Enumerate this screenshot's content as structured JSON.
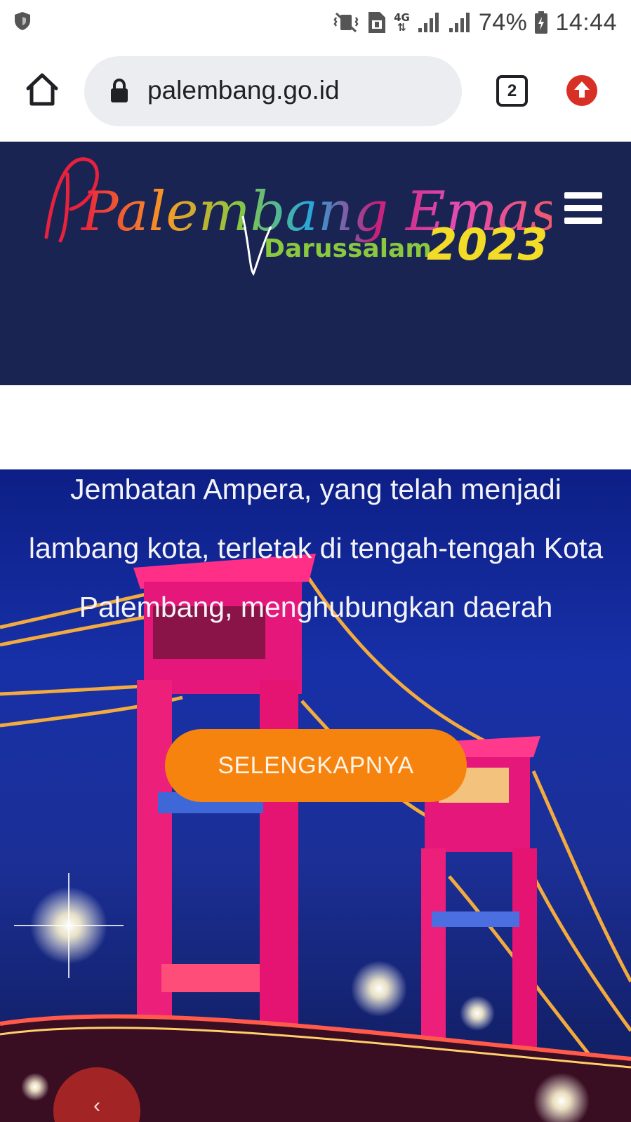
{
  "status_bar": {
    "network": "4G",
    "battery": "74%",
    "time": "14:44"
  },
  "browser": {
    "url": "palembang.go.id",
    "tab_count": "2"
  },
  "header": {
    "logo_script": "Palembang Emas",
    "logo_sub": "Darussalam",
    "logo_year": "2023"
  },
  "hero": {
    "text": "Jembatan Ampera, yang telah menjadi lambang kota, terletak di tengah-tengah Kota Palembang, menghubungkan daerah",
    "button_label": "SELENGKAPNYA",
    "prev_label": "‹"
  },
  "colors": {
    "header_bg": "#1a2452",
    "button_orange": "#f6830d",
    "prev_red": "#a32424"
  }
}
